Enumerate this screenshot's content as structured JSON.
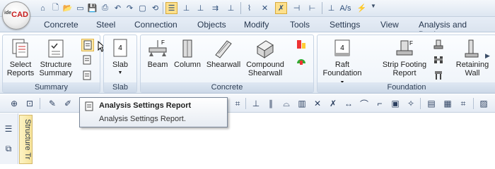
{
  "app": {
    "logo_text": "CAD",
    "logo_prefix": "ide"
  },
  "tabs": [
    {
      "label": "Concrete"
    },
    {
      "label": "Steel"
    },
    {
      "label": "Connection"
    },
    {
      "label": "Objects"
    },
    {
      "label": "Modify"
    },
    {
      "label": "Tools"
    },
    {
      "label": "Settings"
    },
    {
      "label": "View"
    },
    {
      "label": "Analysis and Design"
    }
  ],
  "ribbon": {
    "summary": {
      "label": "Summary",
      "select_reports": [
        "Select",
        "Reports"
      ],
      "structure_summary": [
        "Structure",
        "Summary"
      ]
    },
    "slab": {
      "label": "Slab",
      "slab_button": "Slab"
    },
    "concrete": {
      "label": "Concrete",
      "beam": "Beam",
      "column": "Column",
      "shearwall": "Shearwall",
      "compound_shearwall": [
        "Compound",
        "Shearwall"
      ]
    },
    "foundation": {
      "label": "Foundation",
      "raft": [
        "Raft",
        "Foundation"
      ],
      "strip": [
        "Strip Footing",
        "Report"
      ],
      "retaining": [
        "Retaining",
        "Wall"
      ]
    }
  },
  "tooltip": {
    "title": "Analysis Settings Report",
    "description": "Analysis Settings Report."
  },
  "side_tab": {
    "label": "Structure Tr"
  },
  "colors": {
    "accent": "#fde08c",
    "ribbon_border": "#c7d4e4",
    "logo_red": "#c81b1b"
  }
}
